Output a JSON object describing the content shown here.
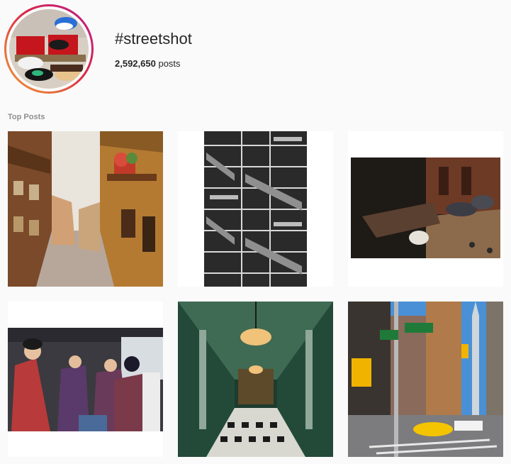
{
  "tag": {
    "name": "#streetshot",
    "post_count": "2,592,650",
    "post_count_suffix": "posts"
  },
  "sections": {
    "top_posts_label": "Top Posts"
  },
  "posts": [
    {
      "subject": "half-timbered street with flower boxes"
    },
    {
      "subject": "black and white fire escape"
    },
    {
      "subject": "hand feeding pigeons"
    },
    {
      "subject": "flight attendants in batik uniforms"
    },
    {
      "subject": "green arcade hallway with chandelier"
    },
    {
      "subject": "new york street with yellow taxi"
    }
  ],
  "colors": {
    "background": "#fafafa",
    "text": "#262626",
    "muted": "#8e8e8e",
    "ring_start": "#f09433",
    "ring_end": "#bc1888"
  }
}
